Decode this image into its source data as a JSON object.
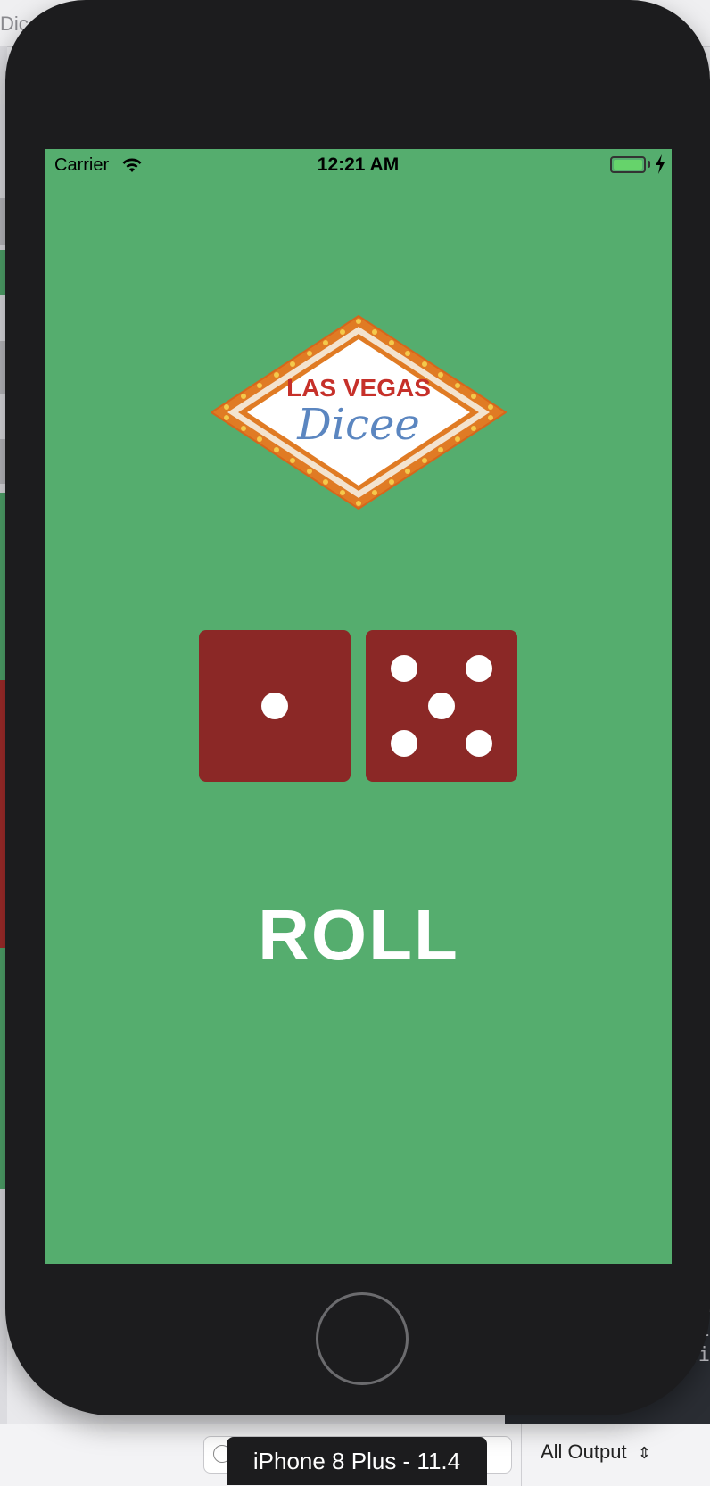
{
  "xcode": {
    "window_title_fragment": "Dic",
    "console_lines": [
      "2",
      "ti"
    ],
    "output_selector": "All Output",
    "simulator_device": "iPhone 8 Plus - 11.4"
  },
  "status_bar": {
    "carrier": "Carrier",
    "time": "12:21 AM",
    "wifi_icon": "wifi-icon",
    "battery_icon": "battery-charging-icon"
  },
  "logo": {
    "line1": "LAS VEGAS",
    "line2": "Dicee"
  },
  "dice": {
    "left_face": 1,
    "right_face": 5,
    "color": "#8b2826"
  },
  "roll_button": {
    "label": "ROLL"
  },
  "colors": {
    "background": "#55ad6e",
    "device_body": "#1c1c1e",
    "logo_red": "#c6302a",
    "logo_blue": "#5b86c0",
    "logo_orange": "#e07b24"
  }
}
